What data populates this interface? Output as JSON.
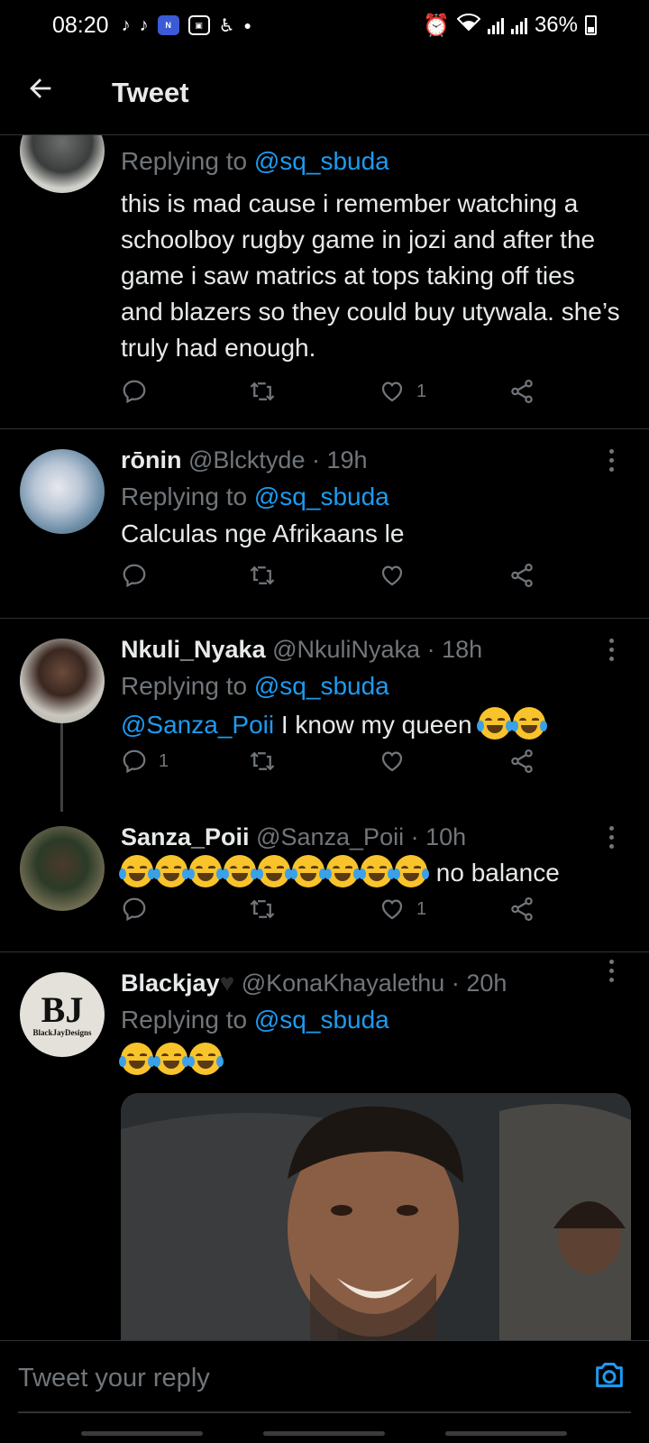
{
  "status_bar": {
    "time": "08:20",
    "battery": "36%",
    "icons": [
      "tiktok-icon",
      "tiktok-icon",
      "news-icon",
      "gallery-icon",
      "accessibility-icon",
      "alarm-icon",
      "wifi-icon",
      "signal-icon",
      "signal-icon",
      "battery-icon"
    ]
  },
  "header": {
    "title": "Tweet"
  },
  "tweets": [
    {
      "replying_prefix": "Replying to",
      "replying_handle": "@sq_sbuda",
      "text": "this is mad cause i remember watching a schoolboy rugby game in jozi and after the game i saw matrics at tops taking off ties and blazers so they could buy utywala. she’s truly had enough.",
      "likes": "1"
    },
    {
      "name": "rōnin",
      "handle": "@Blcktyde",
      "time": "· 19h",
      "replying_prefix": "Replying to",
      "replying_handle": "@sq_sbuda",
      "text": "Calculas nge Afrikaans le"
    },
    {
      "name": "Nkuli_Nyaka",
      "handle": "@NkuliNyaka",
      "time": "· 18h",
      "replying_prefix": "Replying to",
      "replying_handle": "@sq_sbuda",
      "mention": "@Sanza_Poii",
      "text": " I know my queen ",
      "emoji_count": 2,
      "replies": "1"
    },
    {
      "name": "Sanza_Poii",
      "handle": "@Sanza_Poii",
      "time": "· 10h",
      "emoji_count": 9,
      "text": " no balance",
      "likes": "1"
    },
    {
      "name": "Blackjay",
      "handle": "@KonaKhayalethu",
      "time": "· 20h",
      "replying_prefix": "Replying to",
      "replying_handle": "@sq_sbuda",
      "emoji_count": 3,
      "avatar_text": "BJ",
      "avatar_subtext": "BlackJayDesigns"
    }
  ],
  "reply_bar": {
    "placeholder": "Tweet your reply"
  },
  "colors": {
    "background": "#000000",
    "accent": "#1d9bf0",
    "muted": "#71767b",
    "divider": "#2f3336"
  }
}
